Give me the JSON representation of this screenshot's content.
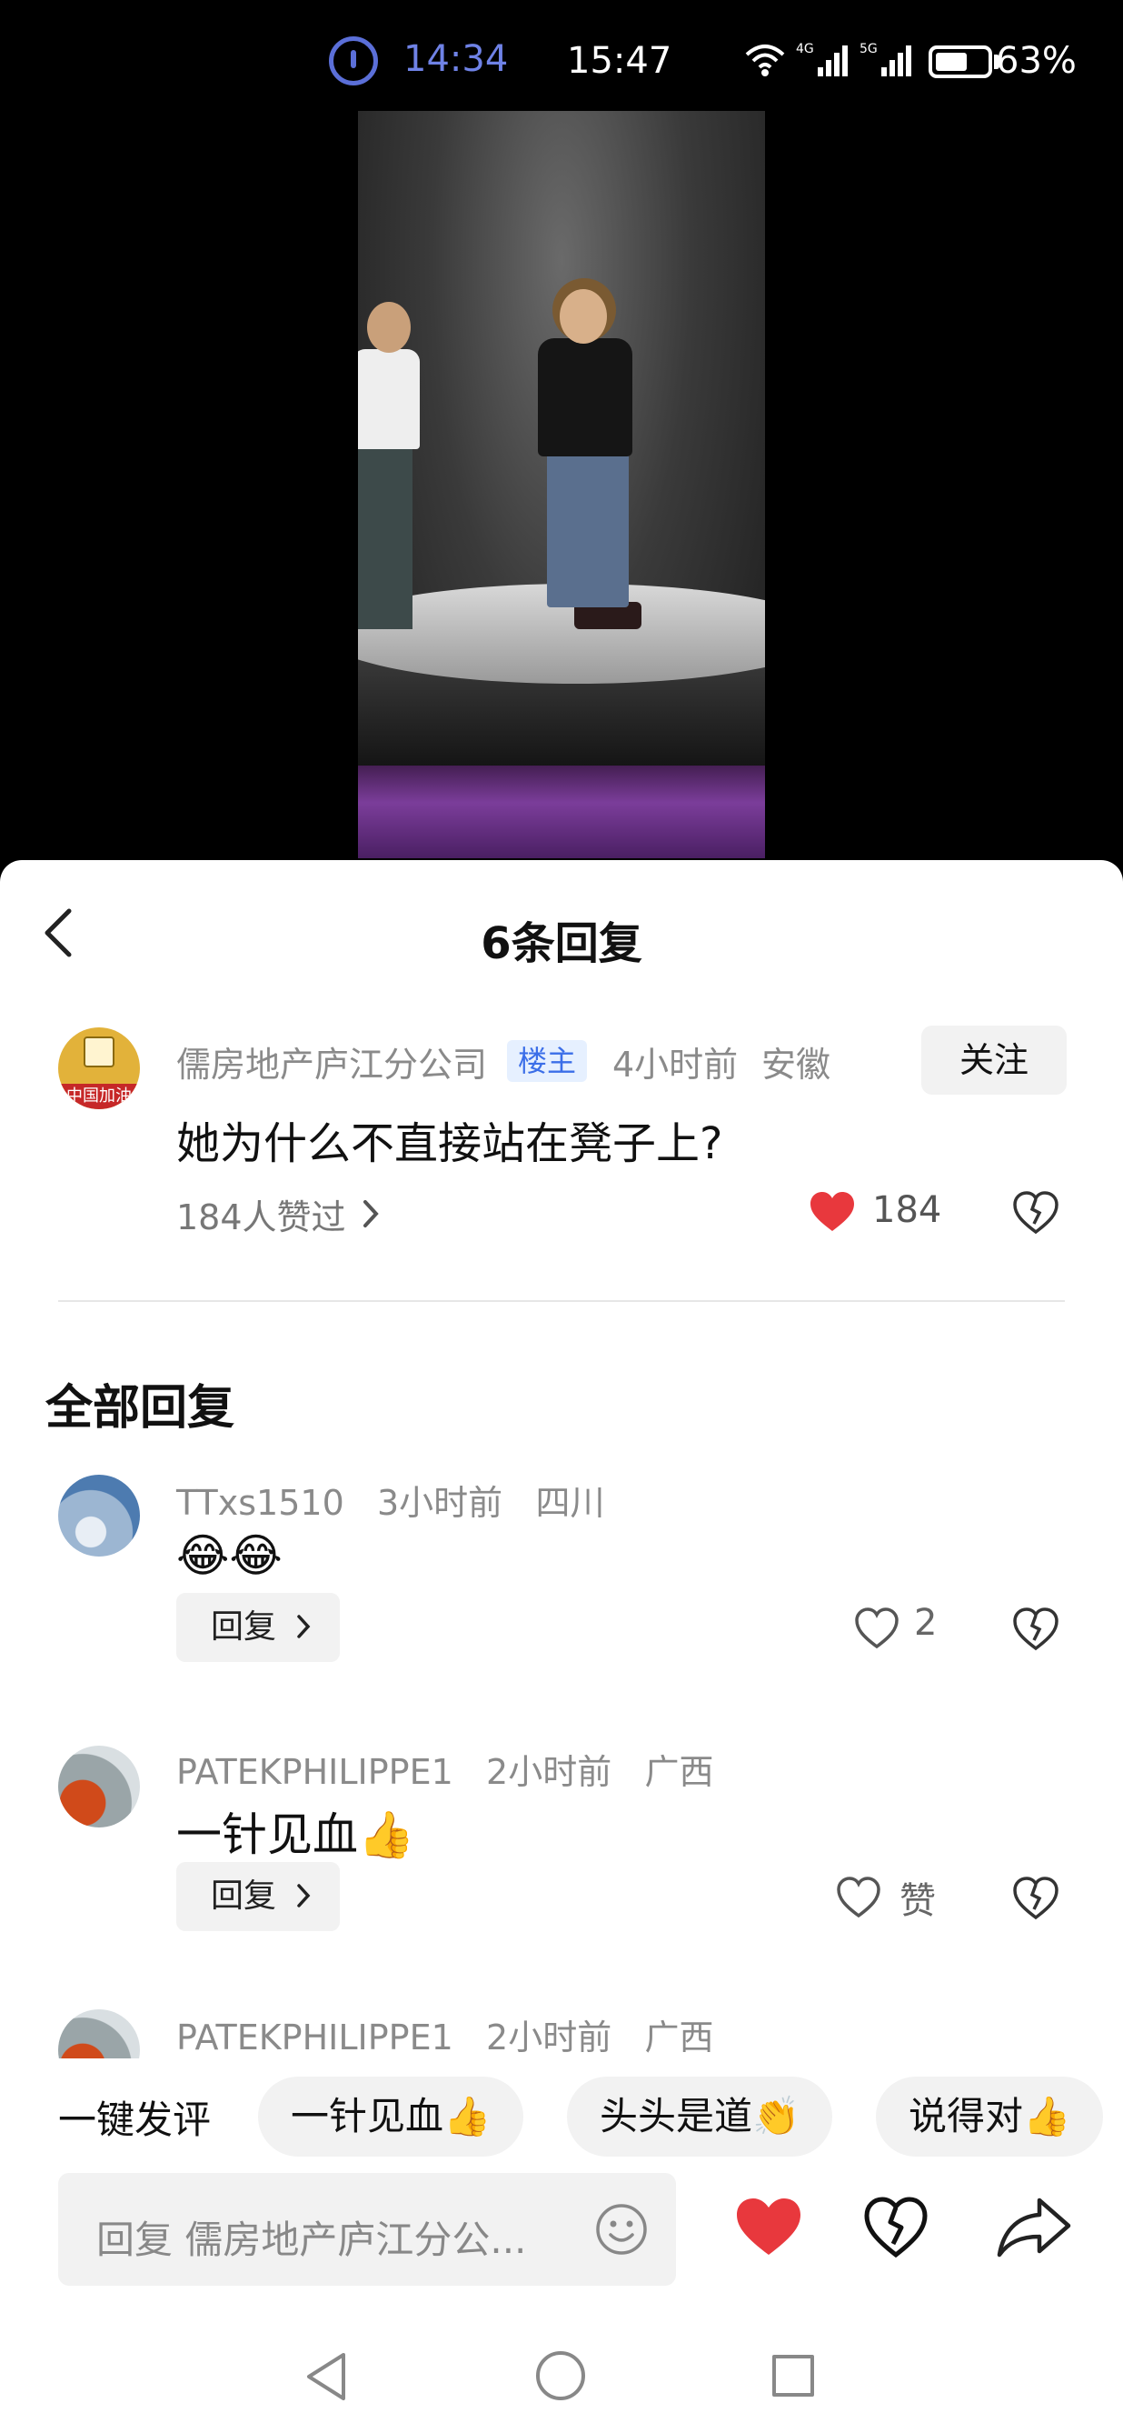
{
  "status_bar": {
    "timer": "14:34",
    "clock": "15:47",
    "network1": "4G",
    "network2": "5G",
    "battery": "63%",
    "battery_level": 0.63
  },
  "panel": {
    "title": "6条回复",
    "op": {
      "author": "儒房地产庐江分公司",
      "badge": "楼主",
      "time": "4小时前",
      "location": "安徽",
      "follow_label": "关注",
      "text": "她为什么不直接站在凳子上?",
      "likes_summary": "184人赞过",
      "like_count": "184",
      "avatar_tag": "中国加油"
    },
    "section_title": "全部回复",
    "replies": [
      {
        "author": "TTxs1510",
        "time": "3小时前",
        "location": "四川",
        "text": "😂😂",
        "reply_label": "回复",
        "likes": "2"
      },
      {
        "author": "PATEKPHILIPPE1",
        "time": "2小时前",
        "location": "广西",
        "text": "一针见血👍",
        "reply_label": "回复",
        "likes": "赞"
      },
      {
        "author": "PATEKPHILIPPE1",
        "time": "2小时前",
        "location": "广西"
      }
    ],
    "quick_comment": {
      "label": "一键发评",
      "chips": [
        "一针见血👍",
        "头头是道👏",
        "说得对👍"
      ]
    },
    "input_placeholder": "回复 儒房地产庐江分公..."
  }
}
